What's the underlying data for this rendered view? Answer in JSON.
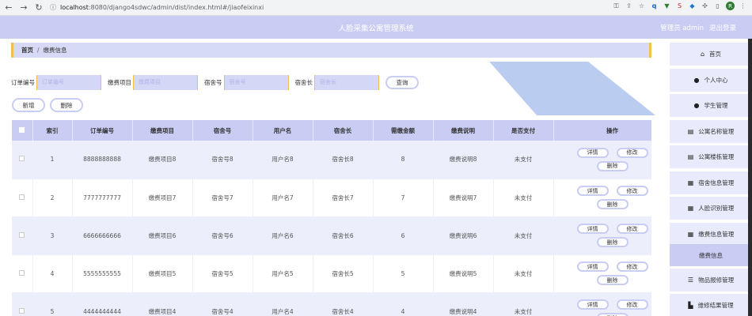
{
  "browser": {
    "url_host": "localhost",
    "url_path": ":8080/django4sdwc/admin/dist/index.html#/jiaofeixinxi",
    "avatar_letter": "R"
  },
  "header": {
    "title": "人脸采集公寓管理系统",
    "role_user": "管理员 admin",
    "logout": "退出登录"
  },
  "breadcrumb": {
    "home": "首页",
    "separator": "/",
    "current": "缴费信息"
  },
  "search": {
    "fields": [
      {
        "label": "订单编号",
        "placeholder": "订单编号"
      },
      {
        "label": "缴费项目",
        "placeholder": "缴费项目"
      },
      {
        "label": "宿舍号",
        "placeholder": "宿舍号"
      },
      {
        "label": "宿舍长",
        "placeholder": "宿舍长"
      }
    ],
    "button": "查询"
  },
  "actions": {
    "add": "新增",
    "delete": "删除"
  },
  "table": {
    "headers": [
      "索引",
      "订单编号",
      "缴费项目",
      "宿舍号",
      "用户名",
      "宿舍长",
      "需缴金额",
      "缴费说明",
      "是否支付",
      "操作"
    ],
    "rows": [
      {
        "index": "1",
        "order": "8888888888",
        "item": "缴费项目8",
        "dorm": "宿舍号8",
        "user": "用户名8",
        "leader": "宿舍长8",
        "amount": "8",
        "desc": "缴费说明8",
        "paid": "未支付"
      },
      {
        "index": "2",
        "order": "7777777777",
        "item": "缴费项目7",
        "dorm": "宿舍号7",
        "user": "用户名7",
        "leader": "宿舍长7",
        "amount": "7",
        "desc": "缴费说明7",
        "paid": "未支付"
      },
      {
        "index": "3",
        "order": "6666666666",
        "item": "缴费项目6",
        "dorm": "宿舍号6",
        "user": "用户名6",
        "leader": "宿舍长6",
        "amount": "6",
        "desc": "缴费说明6",
        "paid": "未支付"
      },
      {
        "index": "4",
        "order": "5555555555",
        "item": "缴费项目5",
        "dorm": "宿舍号5",
        "user": "用户名5",
        "leader": "宿舍长5",
        "amount": "5",
        "desc": "缴费说明5",
        "paid": "未支付"
      },
      {
        "index": "5",
        "order": "4444444444",
        "item": "缴费项目4",
        "dorm": "宿舍号4",
        "user": "用户名4",
        "leader": "宿舍长4",
        "amount": "4",
        "desc": "缴费说明4",
        "paid": "未支付"
      }
    ],
    "op_labels": {
      "detail": "详情",
      "edit": "修改",
      "delete": "删除"
    }
  },
  "sidebar": {
    "items": [
      {
        "label": "首页",
        "icon": "home-icon"
      },
      {
        "label": "个人中心",
        "icon": "user-icon"
      },
      {
        "label": "学生管理",
        "icon": "user-icon"
      },
      {
        "label": "公寓名称管理",
        "icon": "list-icon"
      },
      {
        "label": "公寓楼栋管理",
        "icon": "list-icon"
      },
      {
        "label": "宿舍信息管理",
        "icon": "grid-icon"
      },
      {
        "label": "人脸识别管理",
        "icon": "grid-icon"
      },
      {
        "label": "缴费信息管理",
        "icon": "grid-icon"
      },
      {
        "label": "缴费信息",
        "icon": ""
      },
      {
        "label": "物品报修管理",
        "icon": "sliders-icon"
      },
      {
        "label": "维修结果管理",
        "icon": "chart-icon"
      }
    ]
  },
  "colors": {
    "primary": "#c9cdf3",
    "accent": "#f0c04a",
    "row_alt": "#eceefc"
  }
}
